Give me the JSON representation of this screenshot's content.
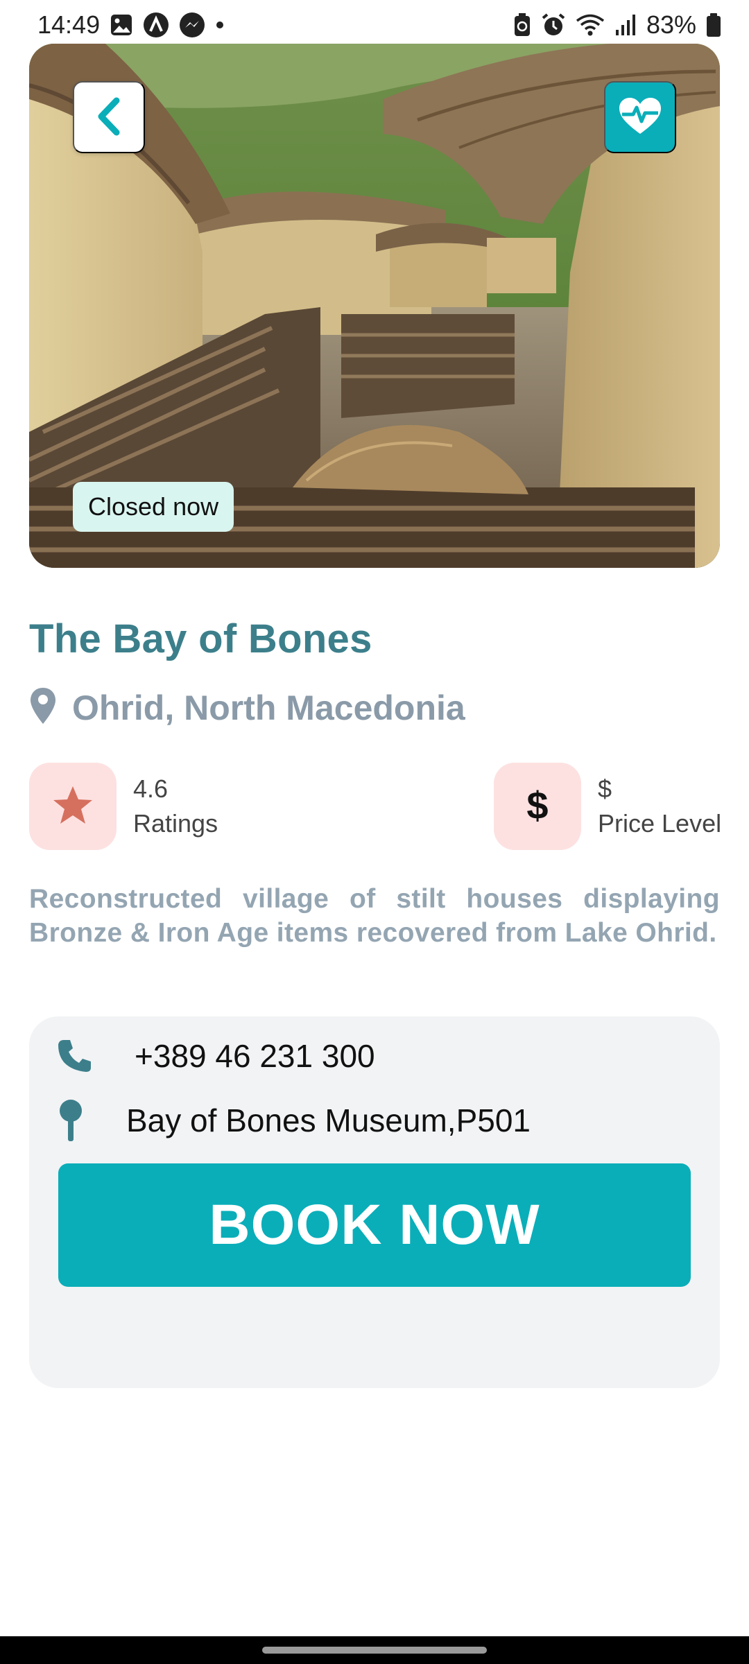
{
  "status_bar": {
    "time": "14:49",
    "battery": "83%",
    "icons_left": [
      "gallery-icon",
      "app-icon",
      "messenger-icon",
      "dot-icon"
    ],
    "icons_right": [
      "battery-saver-icon",
      "alarm-icon",
      "wifi-icon",
      "signal-icon",
      "battery-icon"
    ]
  },
  "hero": {
    "status_label": "Closed now",
    "back_icon": "chevron-left-icon",
    "favorite_icon": "heart-pulse-icon"
  },
  "place": {
    "title": "The Bay of Bones",
    "location": "Ohrid, North Macedonia",
    "description": "Reconstructed village of stilt houses displaying Bronze & Iron Age items recovered from Lake Ohrid."
  },
  "stats": {
    "rating": {
      "value": "4.6",
      "label": "Ratings",
      "icon": "star-icon"
    },
    "price": {
      "value": "$",
      "label": "Price Level",
      "icon": "dollar-icon"
    }
  },
  "contact": {
    "phone": "+389 46 231 300",
    "address": "Bay of Bones Museum,P501"
  },
  "actions": {
    "book_label": "BOOK NOW"
  },
  "colors": {
    "accent": "#0aaeb9",
    "title": "#3c7f8b",
    "muted": "#8a9aa8",
    "icon_bg": "#fde1e1",
    "star": "#d6705e",
    "card_bg": "#f2f3f5",
    "chip_bg": "#d9f5ef"
  }
}
